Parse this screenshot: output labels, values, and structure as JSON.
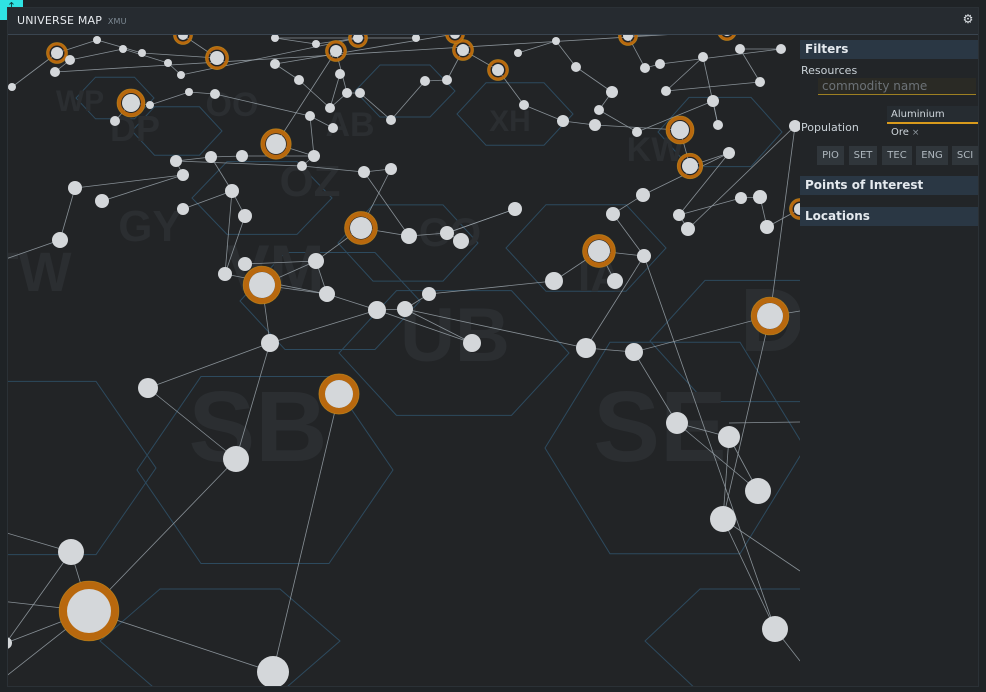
{
  "window": {
    "title": "UNIVERSE MAP",
    "subtitle": "XMU",
    "settings_icon": "gear-icon"
  },
  "corner_button": {
    "label": "↑",
    "color": "#2fe3e3"
  },
  "filters": {
    "heading": "Filters",
    "resources_label": "Resources",
    "commodity_placeholder": "commodity name",
    "selected_tag": "Aluminium Ore",
    "remove_tag_label": "×",
    "population_label": "Population",
    "population_buttons": [
      "PIO",
      "SET",
      "TEC",
      "ENG",
      "SCI"
    ]
  },
  "sections": {
    "points_of_interest": "Points of Interest",
    "locations": "Locations"
  },
  "map": {
    "sector_labels": [
      "WP",
      "DP",
      "OO",
      "OZ",
      "GY",
      "TW",
      "VM",
      "UB",
      "SB",
      "SE",
      "XH",
      "KW",
      "IA",
      "DI",
      "GO",
      "AB"
    ],
    "colors": {
      "hex_stroke": "#2d4a5e",
      "edge": "#9aa3aa",
      "node": "#d4d7da",
      "highlight": "#b8680e",
      "highlight_border": "#c08a1c"
    }
  }
}
